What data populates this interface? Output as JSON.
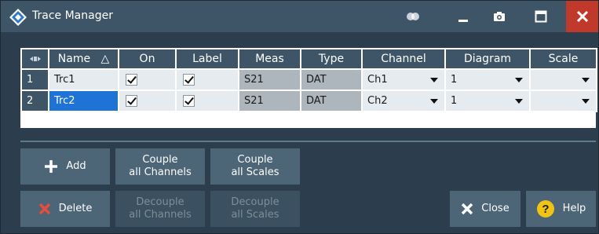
{
  "window": {
    "title": "Trace Manager",
    "close_color": "#c0392b",
    "accent": "#1e74d6"
  },
  "table": {
    "columns": [
      "Name",
      "On",
      "Label",
      "Meas",
      "Type",
      "Channel",
      "Diagram",
      "Scale"
    ],
    "sort_indicator": "△",
    "rows": [
      {
        "num": "1",
        "name": "Trc1",
        "on": true,
        "label": true,
        "meas": "S21",
        "type": "DAT",
        "channel": "Ch1",
        "diagram": "1",
        "scale": "",
        "selected": false
      },
      {
        "num": "2",
        "name": "Trc2",
        "on": true,
        "label": true,
        "meas": "S21",
        "type": "DAT",
        "channel": "Ch2",
        "diagram": "1",
        "scale": "",
        "selected": true
      }
    ]
  },
  "buttons": {
    "add": "Add",
    "delete": "Delete",
    "couple_channels_1": "Couple",
    "couple_channels_2": "all Channels",
    "couple_scales_1": "Couple",
    "couple_scales_2": "all Scales",
    "decouple_channels_1": "Decouple",
    "decouple_channels_2": "all Channels",
    "decouple_scales_1": "Decouple",
    "decouple_scales_2": "all Scales",
    "close": "Close",
    "help": "Help"
  }
}
